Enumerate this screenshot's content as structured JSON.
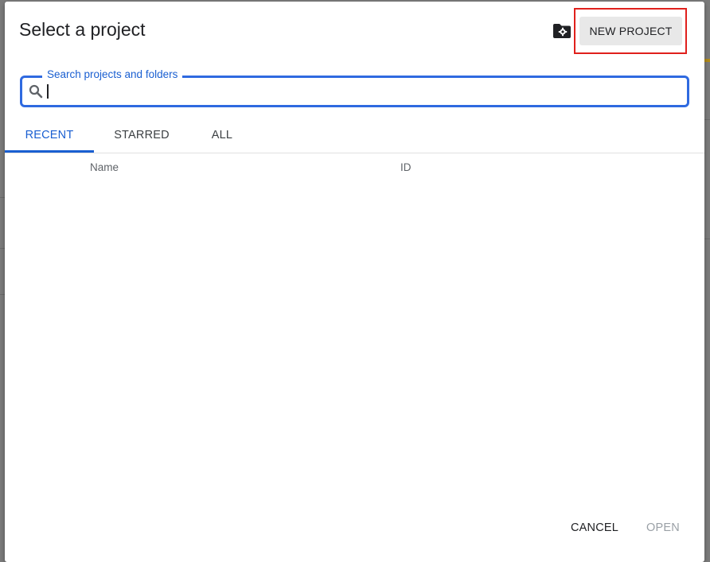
{
  "dialog": {
    "title": "Select a project",
    "new_project_label": "NEW PROJECT",
    "manage_folders_icon": "folder-gear-icon"
  },
  "search": {
    "label": "Search projects and folders",
    "value": "",
    "icon": "search-icon"
  },
  "tabs": [
    {
      "label": "RECENT",
      "active": true
    },
    {
      "label": "STARRED",
      "active": false
    },
    {
      "label": "ALL",
      "active": false
    }
  ],
  "table": {
    "columns": [
      "Name",
      "ID"
    ],
    "rows": []
  },
  "footer": {
    "cancel_label": "CANCEL",
    "open_label": "OPEN",
    "open_enabled": false
  },
  "colors": {
    "accent": "#1a5fd1",
    "highlight": "#e0201c"
  }
}
